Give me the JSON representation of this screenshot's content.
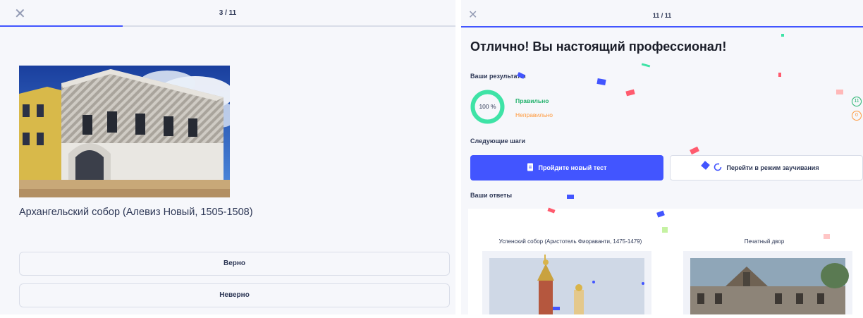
{
  "left": {
    "counter": "3 / 11",
    "progress": 0.27,
    "term": "Архангельский собор (Алевиз Новый, 1505-1508)",
    "options": [
      "Верно",
      "Неверно"
    ]
  },
  "right": {
    "counter": "11 / 11",
    "headline": "Отлично! Вы настоящий профессионал!",
    "results_title": "Ваши результаты",
    "score_percent": "100 %",
    "score_fraction": 1.0,
    "correct_label": "Правильно",
    "wrong_label": "Неправильно",
    "correct_count": "11",
    "wrong_count": "0",
    "next_steps_title": "Следующие шаги",
    "primary_button": "Пройдите новый тест",
    "secondary_button": "Перейти в режим заучивания",
    "answers_title": "Ваши ответы",
    "cards": [
      {
        "title": "Успенский собор (Аристотель Фиораванти, 1475-1479)"
      },
      {
        "title": "Печатный двор"
      }
    ]
  },
  "colors": {
    "accent": "#4255ff",
    "correct": "#23b26d",
    "wrong": "#ff983a",
    "text": "#2e3856"
  },
  "icons": [
    "close-icon",
    "document-icon",
    "refresh-icon"
  ]
}
